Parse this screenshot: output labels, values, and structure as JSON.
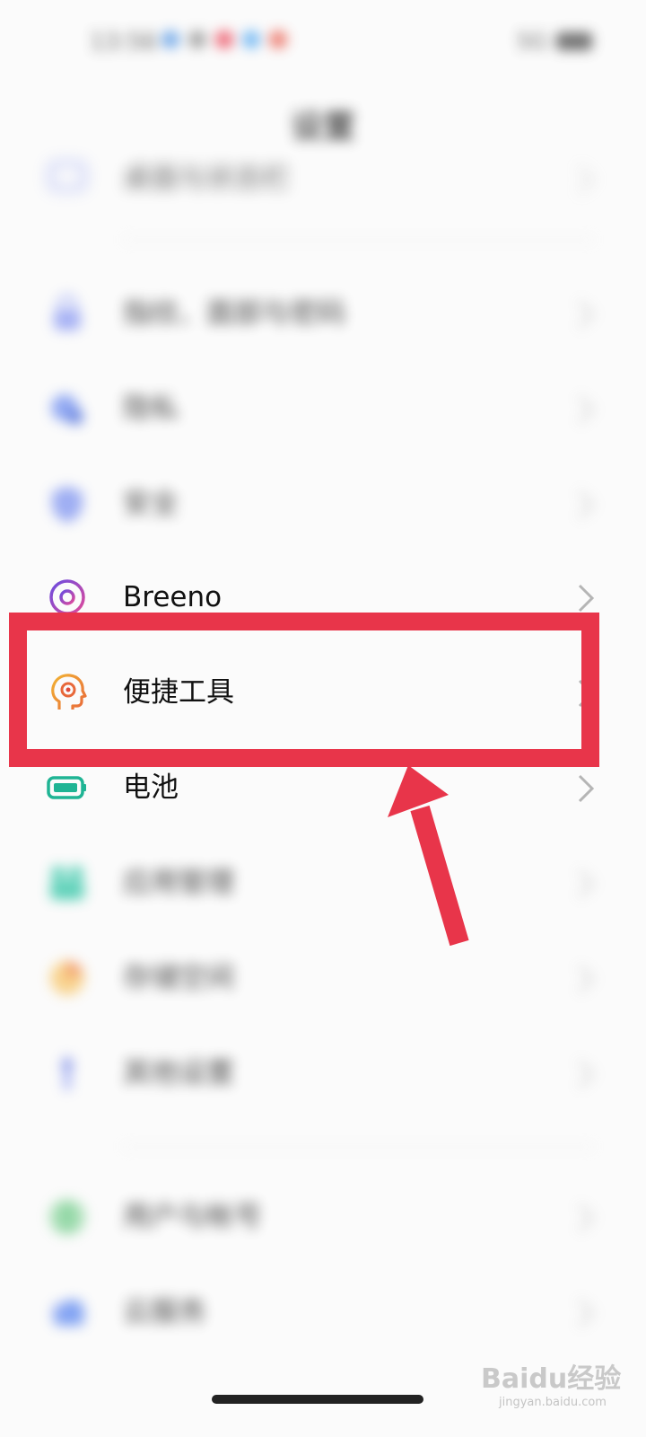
{
  "status_bar": {
    "time": "13:56",
    "network": "5G",
    "dot_colors": [
      "#4a90e2",
      "#888888",
      "#e8354a",
      "#4aa3f0",
      "#e85545"
    ]
  },
  "header": {
    "title": "设置"
  },
  "settings": {
    "items": [
      {
        "label": "桌面与状态栏",
        "icon": "desktop-icon",
        "blurred": true,
        "color": "#7b8cf0"
      },
      {
        "label": "指纹、面部与密码",
        "icon": "lock-icon",
        "blurred": true,
        "color": "#7b8cf0"
      },
      {
        "label": "隐私",
        "icon": "privacy-icon",
        "blurred": true,
        "color": "#5a7de8"
      },
      {
        "label": "安全",
        "icon": "shield-icon",
        "blurred": true,
        "color": "#6a86ee"
      },
      {
        "label": "Breeno",
        "icon": "breeno-icon",
        "blurred": false,
        "color": "#a84ad8"
      },
      {
        "label": "便捷工具",
        "icon": "convenience-tools-icon",
        "blurred": false,
        "color": "#f0a030"
      },
      {
        "label": "电池",
        "icon": "battery-icon",
        "blurred": false,
        "color": "#1fb494"
      },
      {
        "label": "应用管理",
        "icon": "app-management-icon",
        "blurred": true,
        "color": "#2cc4a4"
      },
      {
        "label": "存储空间",
        "icon": "storage-icon",
        "blurred": true,
        "color": "#f4a23a"
      },
      {
        "label": "其他设置",
        "icon": "other-settings-icon",
        "blurred": true,
        "color": "#7b8cf0"
      },
      {
        "label": "用户与帐号",
        "icon": "user-icon",
        "blurred": true,
        "color": "#4cc070"
      },
      {
        "label": "云服务",
        "icon": "cloud-icon",
        "blurred": true,
        "color": "#5a86f0"
      }
    ]
  },
  "annotation": {
    "highlight_color": "#e8354a",
    "highlighted_item": "便捷工具"
  },
  "watermark": {
    "text": "Baidu经验",
    "sub": "jingyan.baidu.com"
  }
}
